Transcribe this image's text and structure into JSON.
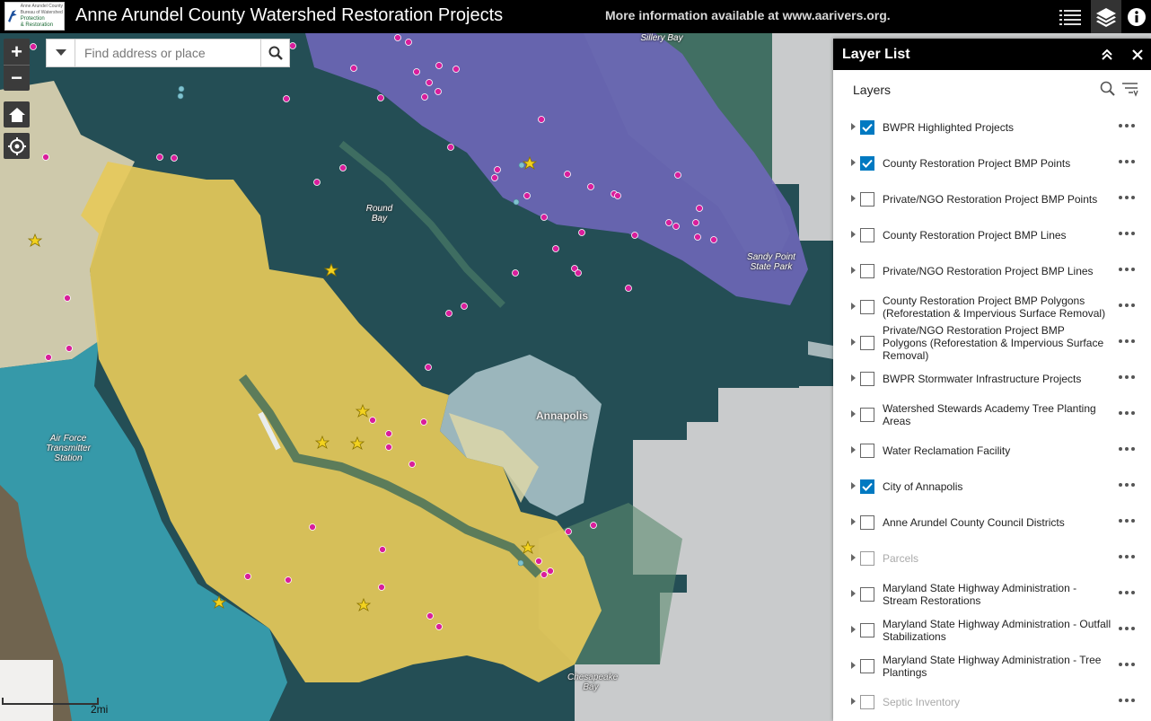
{
  "header": {
    "logo_line1": "Anne Arundel County",
    "logo_line2": "Bureau of Watershed",
    "logo_line3": "Protection",
    "logo_line4": "& Restoration",
    "title": "Anne Arundel County Watershed Restoration Projects",
    "info": "More information available at www.aarivers.org.",
    "icons": [
      "list-icon",
      "layers-icon",
      "info-icon"
    ]
  },
  "map": {
    "search_placeholder": "Find address or place",
    "scale_label": "2mi",
    "labels": {
      "sillery_bay": "Sillery Bay",
      "round_bay": "Round Bay",
      "sandy_point": "Sandy Point State Park",
      "annapolis": "Annapolis",
      "air_force": "Air Force Transmitter Station",
      "chesapeake": "Chesapeake Bay"
    }
  },
  "panel": {
    "title": "Layer List",
    "section": "Layers",
    "layers": [
      {
        "title": "BWPR Highlighted Projects",
        "checked": true,
        "disabled": false
      },
      {
        "title": "County Restoration Project BMP Points",
        "checked": true,
        "disabled": false
      },
      {
        "title": "Private/NGO Restoration Project BMP Points",
        "checked": false,
        "disabled": false
      },
      {
        "title": "County Restoration Project BMP Lines",
        "checked": false,
        "disabled": false
      },
      {
        "title": "Private/NGO Restoration Project BMP Lines",
        "checked": false,
        "disabled": false
      },
      {
        "title": "County Restoration Project BMP Polygons (Reforestation & Impervious Surface Removal)",
        "checked": false,
        "disabled": false
      },
      {
        "title": "Private/NGO Restoration Project BMP Polygons (Reforestation & Impervious Surface Removal)",
        "checked": false,
        "disabled": false
      },
      {
        "title": "BWPR Stormwater Infrastructure Projects",
        "checked": false,
        "disabled": false
      },
      {
        "title": "Watershed Stewards Academy Tree Planting Areas",
        "checked": false,
        "disabled": false
      },
      {
        "title": "Water Reclamation Facility",
        "checked": false,
        "disabled": false
      },
      {
        "title": "City of Annapolis",
        "checked": true,
        "disabled": false
      },
      {
        "title": "Anne Arundel County Council Districts",
        "checked": false,
        "disabled": false
      },
      {
        "title": "Parcels",
        "checked": false,
        "disabled": true
      },
      {
        "title": "Maryland State Highway Administration - Stream Restorations",
        "checked": false,
        "disabled": false
      },
      {
        "title": "Maryland State Highway Administration - Outfall Stabilizations",
        "checked": false,
        "disabled": false
      },
      {
        "title": "Maryland State Highway Administration - Tree Plantings",
        "checked": false,
        "disabled": false
      },
      {
        "title": "Septic Inventory",
        "checked": false,
        "disabled": true
      }
    ]
  }
}
